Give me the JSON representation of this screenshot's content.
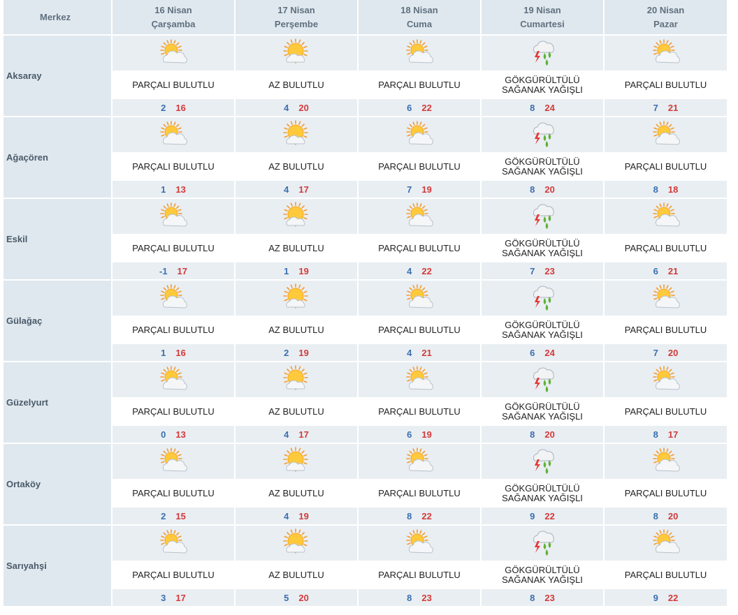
{
  "header": {
    "merkez": "Merkez",
    "days": [
      {
        "date": "16 Nisan",
        "weekday": "Çarşamba"
      },
      {
        "date": "17 Nisan",
        "weekday": "Perşembe"
      },
      {
        "date": "18 Nisan",
        "weekday": "Cuma"
      },
      {
        "date": "19 Nisan",
        "weekday": "Cumartesi"
      },
      {
        "date": "20 Nisan",
        "weekday": "Pazar"
      }
    ]
  },
  "icon_names": {
    "PARÇALI BULUTLU": "partly-cloudy-icon",
    "AZ BULUTLU": "mostly-sunny-icon",
    "GÖKGÜRÜLTÜLÜ SAĞANAK YAĞIŞLI": "thunderstorm-rain-icon"
  },
  "colors": {
    "min_temp": "#3a6fb0",
    "max_temp": "#d23a3a",
    "header_bg": "#dfe8ee",
    "row_bg": "#e9eef2"
  },
  "rows": [
    {
      "city": "Aksaray",
      "forecasts": [
        {
          "desc": [
            "PARÇALI BULUTLU"
          ],
          "icon": "partly-cloudy-icon",
          "min": "2",
          "max": "16"
        },
        {
          "desc": [
            "AZ BULUTLU"
          ],
          "icon": "mostly-sunny-icon",
          "min": "4",
          "max": "20"
        },
        {
          "desc": [
            "PARÇALI BULUTLU"
          ],
          "icon": "partly-cloudy-icon",
          "min": "6",
          "max": "22"
        },
        {
          "desc": [
            "GÖKGÜRÜLTÜLÜ",
            "SAĞANAK YAĞIŞLI"
          ],
          "icon": "thunderstorm-rain-icon",
          "min": "8",
          "max": "24"
        },
        {
          "desc": [
            "PARÇALI BULUTLU"
          ],
          "icon": "partly-cloudy-icon",
          "min": "7",
          "max": "21"
        }
      ]
    },
    {
      "city": "Ağaçören",
      "forecasts": [
        {
          "desc": [
            "PARÇALI BULUTLU"
          ],
          "icon": "partly-cloudy-icon",
          "min": "1",
          "max": "13"
        },
        {
          "desc": [
            "AZ BULUTLU"
          ],
          "icon": "mostly-sunny-icon",
          "min": "4",
          "max": "17"
        },
        {
          "desc": [
            "PARÇALI BULUTLU"
          ],
          "icon": "partly-cloudy-icon",
          "min": "7",
          "max": "19"
        },
        {
          "desc": [
            "GÖKGÜRÜLTÜLÜ",
            "SAĞANAK YAĞIŞLI"
          ],
          "icon": "thunderstorm-rain-icon",
          "min": "8",
          "max": "20"
        },
        {
          "desc": [
            "PARÇALI BULUTLU"
          ],
          "icon": "partly-cloudy-icon",
          "min": "8",
          "max": "18"
        }
      ]
    },
    {
      "city": "Eskil",
      "forecasts": [
        {
          "desc": [
            "PARÇALI BULUTLU"
          ],
          "icon": "partly-cloudy-icon",
          "min": "-1",
          "max": "17"
        },
        {
          "desc": [
            "AZ BULUTLU"
          ],
          "icon": "mostly-sunny-icon",
          "min": "1",
          "max": "19"
        },
        {
          "desc": [
            "PARÇALI BULUTLU"
          ],
          "icon": "partly-cloudy-icon",
          "min": "4",
          "max": "22"
        },
        {
          "desc": [
            "GÖKGÜRÜLTÜLÜ",
            "SAĞANAK YAĞIŞLI"
          ],
          "icon": "thunderstorm-rain-icon",
          "min": "7",
          "max": "23"
        },
        {
          "desc": [
            "PARÇALI BULUTLU"
          ],
          "icon": "partly-cloudy-icon",
          "min": "6",
          "max": "21"
        }
      ]
    },
    {
      "city": "Gülağaç",
      "forecasts": [
        {
          "desc": [
            "PARÇALI BULUTLU"
          ],
          "icon": "partly-cloudy-icon",
          "min": "1",
          "max": "16"
        },
        {
          "desc": [
            "AZ BULUTLU"
          ],
          "icon": "mostly-sunny-icon",
          "min": "2",
          "max": "19"
        },
        {
          "desc": [
            "PARÇALI BULUTLU"
          ],
          "icon": "partly-cloudy-icon",
          "min": "4",
          "max": "21"
        },
        {
          "desc": [
            "GÖKGÜRÜLTÜLÜ",
            "SAĞANAK YAĞIŞLI"
          ],
          "icon": "thunderstorm-rain-icon",
          "min": "6",
          "max": "24"
        },
        {
          "desc": [
            "PARÇALI BULUTLU"
          ],
          "icon": "partly-cloudy-icon",
          "min": "7",
          "max": "20"
        }
      ]
    },
    {
      "city": "Güzelyurt",
      "forecasts": [
        {
          "desc": [
            "PARÇALI BULUTLU"
          ],
          "icon": "partly-cloudy-icon",
          "min": "0",
          "max": "13"
        },
        {
          "desc": [
            "AZ BULUTLU"
          ],
          "icon": "mostly-sunny-icon",
          "min": "4",
          "max": "17"
        },
        {
          "desc": [
            "PARÇALI BULUTLU"
          ],
          "icon": "partly-cloudy-icon",
          "min": "6",
          "max": "19"
        },
        {
          "desc": [
            "GÖKGÜRÜLTÜLÜ",
            "SAĞANAK YAĞIŞLI"
          ],
          "icon": "thunderstorm-rain-icon",
          "min": "8",
          "max": "20"
        },
        {
          "desc": [
            "PARÇALI BULUTLU"
          ],
          "icon": "partly-cloudy-icon",
          "min": "8",
          "max": "17"
        }
      ]
    },
    {
      "city": "Ortaköy",
      "forecasts": [
        {
          "desc": [
            "PARÇALI BULUTLU"
          ],
          "icon": "partly-cloudy-icon",
          "min": "2",
          "max": "15"
        },
        {
          "desc": [
            "AZ BULUTLU"
          ],
          "icon": "mostly-sunny-icon",
          "min": "4",
          "max": "19"
        },
        {
          "desc": [
            "PARÇALI BULUTLU"
          ],
          "icon": "partly-cloudy-icon",
          "min": "8",
          "max": "22"
        },
        {
          "desc": [
            "GÖKGÜRÜLTÜLÜ",
            "SAĞANAK YAĞIŞLI"
          ],
          "icon": "thunderstorm-rain-icon",
          "min": "9",
          "max": "22"
        },
        {
          "desc": [
            "PARÇALI BULUTLU"
          ],
          "icon": "partly-cloudy-icon",
          "min": "8",
          "max": "20"
        }
      ]
    },
    {
      "city": "Sarıyahşi",
      "forecasts": [
        {
          "desc": [
            "PARÇALI BULUTLU"
          ],
          "icon": "partly-cloudy-icon",
          "min": "3",
          "max": "17"
        },
        {
          "desc": [
            "AZ BULUTLU"
          ],
          "icon": "mostly-sunny-icon",
          "min": "5",
          "max": "20"
        },
        {
          "desc": [
            "PARÇALI BULUTLU"
          ],
          "icon": "partly-cloudy-icon",
          "min": "8",
          "max": "23"
        },
        {
          "desc": [
            "GÖKGÜRÜLTÜLÜ",
            "SAĞANAK YAĞIŞLI"
          ],
          "icon": "thunderstorm-rain-icon",
          "min": "8",
          "max": "23"
        },
        {
          "desc": [
            "PARÇALI BULUTLU"
          ],
          "icon": "partly-cloudy-icon",
          "min": "9",
          "max": "22"
        }
      ]
    }
  ]
}
